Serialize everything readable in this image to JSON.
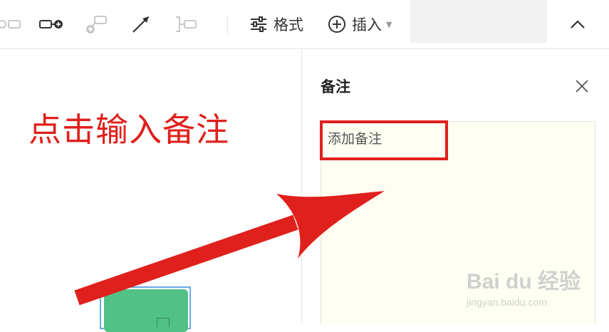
{
  "toolbar": {
    "format_label": "格式",
    "insert_label": "插入",
    "icons": [
      "topic-icon",
      "subtopic-icon",
      "float-topic-icon",
      "relationship-icon",
      "summary-icon"
    ]
  },
  "canvas": {
    "annotation": "点击输入备注",
    "annotation_color": "#e0201c",
    "node_color": "#52c185"
  },
  "panel": {
    "title": "备注",
    "placeholder": "添加备注"
  },
  "watermark": {
    "main": "Bai du 经验",
    "sub": "jingyan.baidu.com"
  }
}
